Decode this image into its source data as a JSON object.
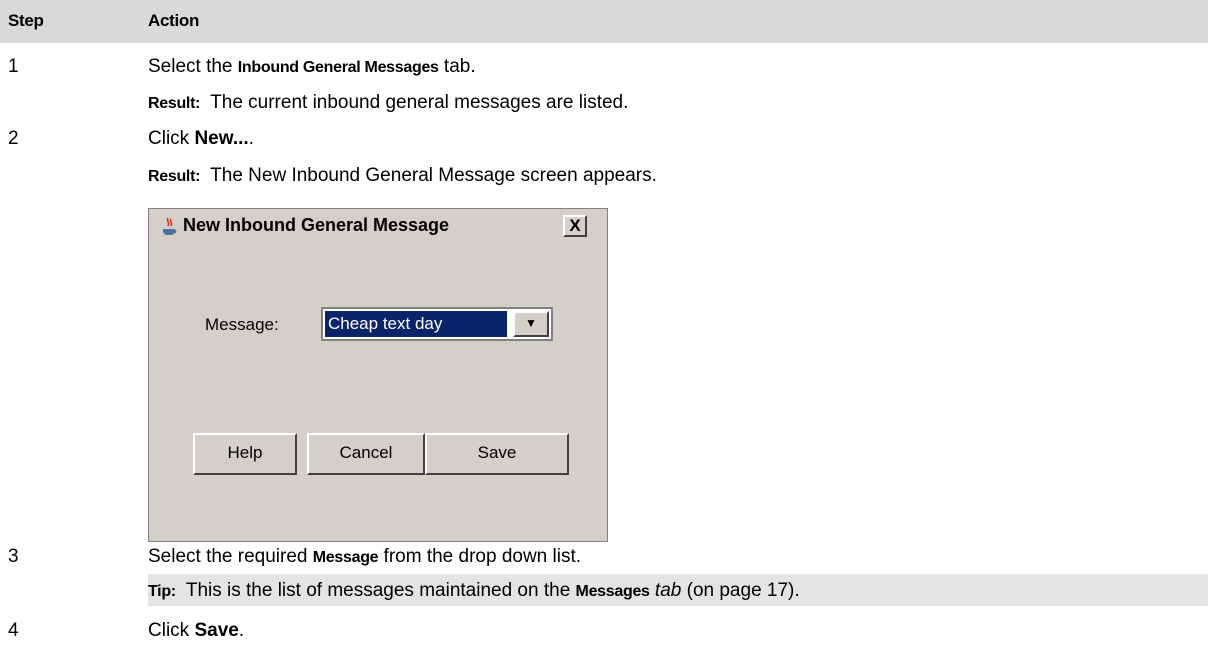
{
  "table": {
    "header": {
      "step": "Step",
      "action": "Action"
    },
    "rows": {
      "r1": {
        "step": "1",
        "pre": "Select the ",
        "bold": "Inbound General Messages",
        "post": " tab.",
        "result_label": "Result:",
        "result_text": "The current inbound general messages are listed."
      },
      "r2": {
        "step": "2",
        "pre": "Click ",
        "bold": "New...",
        "post": ".",
        "result_label": "Result:",
        "result_text": "The New Inbound General Message screen appears."
      },
      "r3": {
        "step": "3",
        "pre": "Select the required ",
        "bold": "Message",
        "post": " from the drop down list.",
        "tip_label": "Tip:",
        "tip_pre": "This is the list of messages maintained on the ",
        "tip_bold": "Messages",
        "tip_italic": "tab",
        "tip_post": " (on page 17)."
      },
      "r4": {
        "step": "4",
        "pre": "Click ",
        "bold": "Save",
        "post": "."
      }
    }
  },
  "dialog": {
    "title": "New Inbound General Message",
    "close_glyph": "X",
    "message_label": "Message:",
    "message_value": "Cheap text day",
    "dropdown_glyph": "▼",
    "buttons": {
      "help": "Help",
      "cancel": "Cancel",
      "save": "Save"
    }
  }
}
